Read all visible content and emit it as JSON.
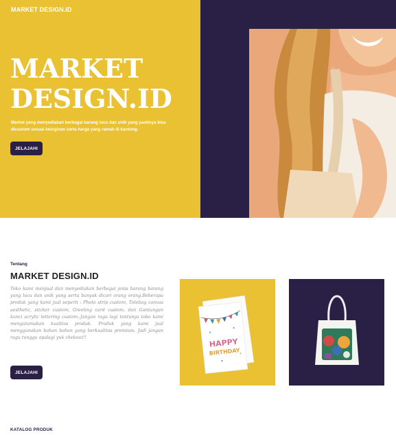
{
  "header": {
    "brand": "MARKET DESIGN.ID"
  },
  "hero": {
    "title_line1": "MARKET",
    "title_line2": "DESIGN.ID",
    "description": "Market yang menyediakan berbagai barang lucu dan unik yang pastinya bisa dicustom sesuai keinginan serta harga yang ramah di kantong.",
    "button_label": "JELAJAHI"
  },
  "about": {
    "kicker": "Tentang",
    "title": "MARKET DESIGN.ID",
    "text": "Toko kami menjual dan menyediakan berbagai jenis barang barang yang lucu dan unik yang serta banyak dicari orang orang.Beberapa produk yang kami jual seperti : Photo strip custom, Totebag canvas aesthetic, sticker custom, Greeting card custom, dan Gantungan kunci acrylic lettering custom..Jangan ragu lagi tentunya toko kami mengutamakan kualitas produk. Produk yang kami jual menggunakan bahan bahan yang berkualitas premium. Jadi jangan ragu tunggu apalagi yuk chekout!!",
    "button_label": "JELAJAHI",
    "card_text_line1": "HAPPY",
    "card_text_line2": "BIRTHDAY"
  },
  "catalog": {
    "heading": "KATALOG PRODUK"
  },
  "colors": {
    "yellow": "#e9c132",
    "navy": "#2a2045",
    "white": "#ffffff"
  }
}
